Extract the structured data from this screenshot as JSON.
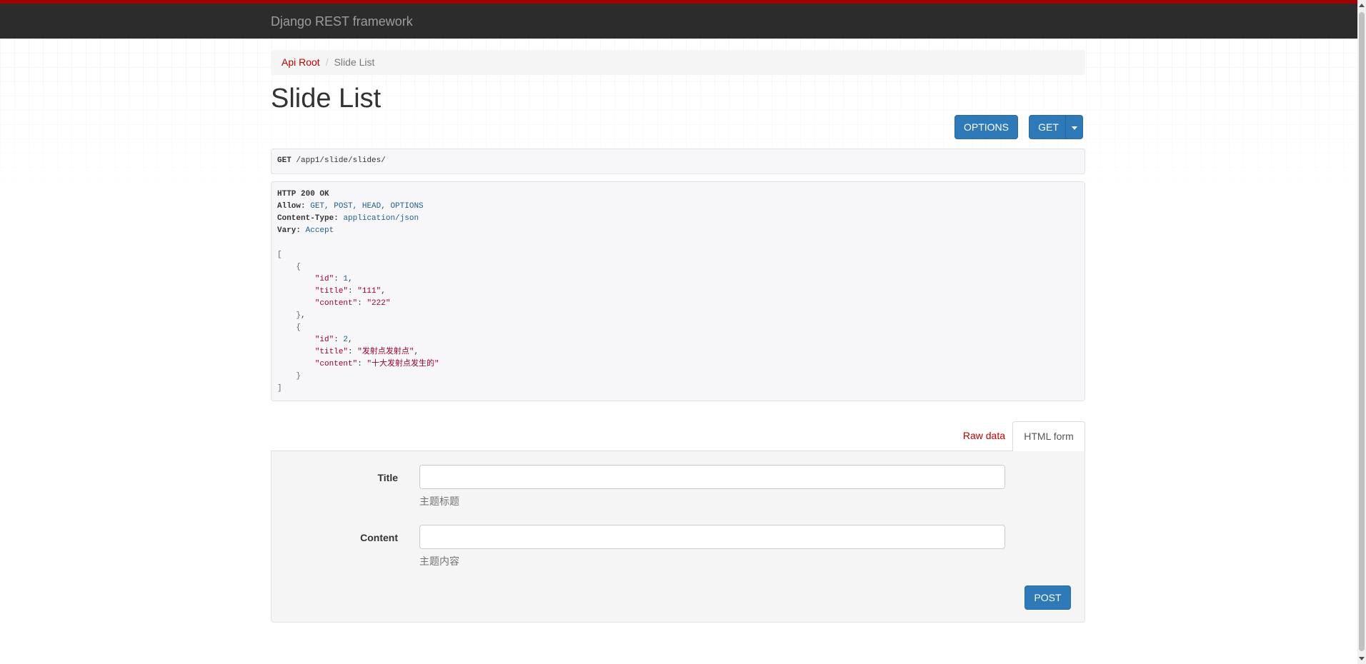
{
  "navbar": {
    "brand": "Django REST framework"
  },
  "breadcrumb": {
    "root": "Api Root",
    "separator": "/",
    "current": "Slide List"
  },
  "page": {
    "title": "Slide List"
  },
  "buttons": {
    "options": "OPTIONS",
    "get": "GET",
    "post": "POST"
  },
  "request": {
    "method": "GET",
    "path": "/app1/slide/slides/"
  },
  "response": {
    "status": "HTTP 200 OK",
    "headers": [
      {
        "name": "Allow",
        "value": "GET, POST, HEAD, OPTIONS"
      },
      {
        "name": "Content-Type",
        "value": "application/json"
      },
      {
        "name": "Vary",
        "value": "Accept"
      }
    ],
    "items": [
      {
        "id": "1",
        "title": "\"111\"",
        "content": "\"222\""
      },
      {
        "id": "2",
        "title": "\"发射点发射点\"",
        "content": "\"十大发射点发生的\""
      }
    ],
    "keys": {
      "id": "\"id\"",
      "title": "\"title\"",
      "content": "\"content\""
    }
  },
  "tabs": {
    "raw": "Raw data",
    "html": "HTML form"
  },
  "form": {
    "title": {
      "label": "Title",
      "value": "",
      "help": "主题标题"
    },
    "content": {
      "label": "Content",
      "value": "",
      "help": "主题内容"
    }
  },
  "colors": {
    "accent": "#a30000",
    "navbar": "#2c2c2c",
    "link": "#c20000",
    "primary_button": "#2e7ab8"
  }
}
